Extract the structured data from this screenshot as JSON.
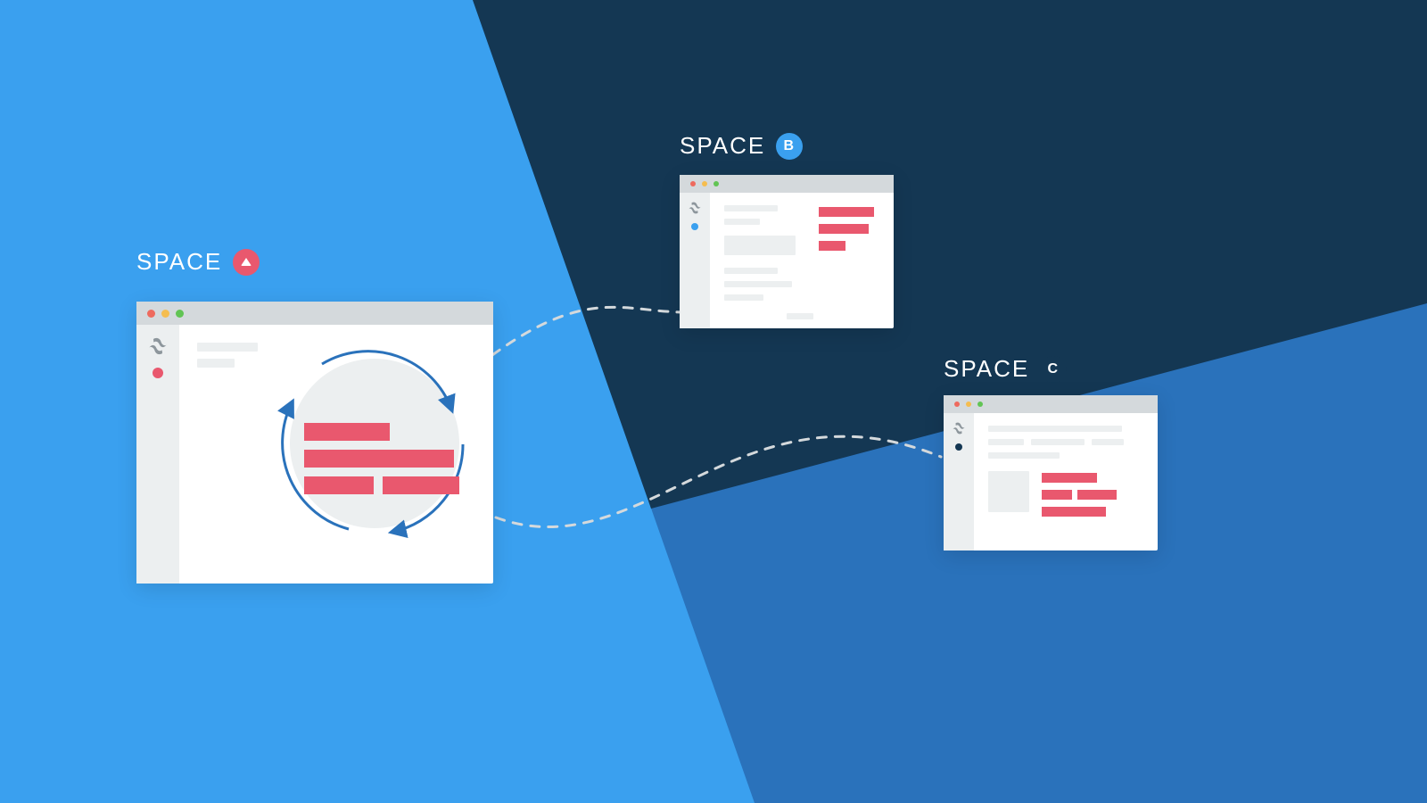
{
  "spaces": {
    "a": {
      "label": "SPACE",
      "badge_shape": "triangle",
      "accent": "#e9586e"
    },
    "b": {
      "label": "SPACE",
      "badge_letter": "B",
      "accent": "#3aa0ef"
    },
    "c": {
      "label": "SPACE",
      "badge_letter": "C",
      "accent": "#143753"
    }
  },
  "colors": {
    "bg_light_blue": "#3aa0ef",
    "bg_mid_blue": "#2a72bb",
    "bg_navy": "#143753",
    "content_red": "#e9586e",
    "chrome_grey": "#d4d9dc",
    "sidebar_grey": "#eceff0"
  },
  "diagram": {
    "concept": "content-syncing-between-spaces",
    "source_space": "a",
    "target_spaces": [
      "b",
      "c"
    ],
    "connectors": [
      {
        "from": "a",
        "to": "b",
        "style": "dashed"
      },
      {
        "from": "a",
        "to": "c",
        "style": "dashed"
      }
    ]
  }
}
